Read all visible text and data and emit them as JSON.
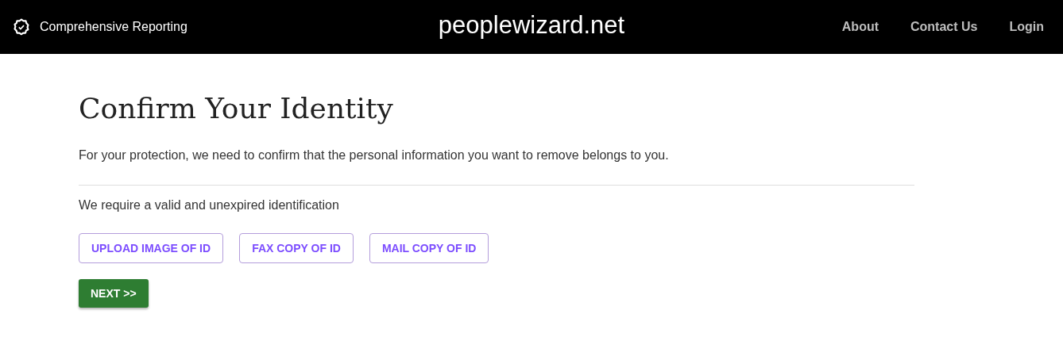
{
  "header": {
    "brand": "Comprehensive Reporting",
    "site_title": "peoplewizard.net",
    "nav": [
      "About",
      "Contact Us",
      "Login"
    ]
  },
  "page": {
    "title": "Confirm Your Identity",
    "intro": "For your protection, we need to confirm that the personal information you want to remove belongs to you.",
    "requirement": "We require a valid and unexpired identification",
    "id_options": [
      "UPLOAD IMAGE OF ID",
      "FAX COPY OF ID",
      "MAIL COPY OF ID"
    ],
    "next_button": "NEXT >>"
  }
}
